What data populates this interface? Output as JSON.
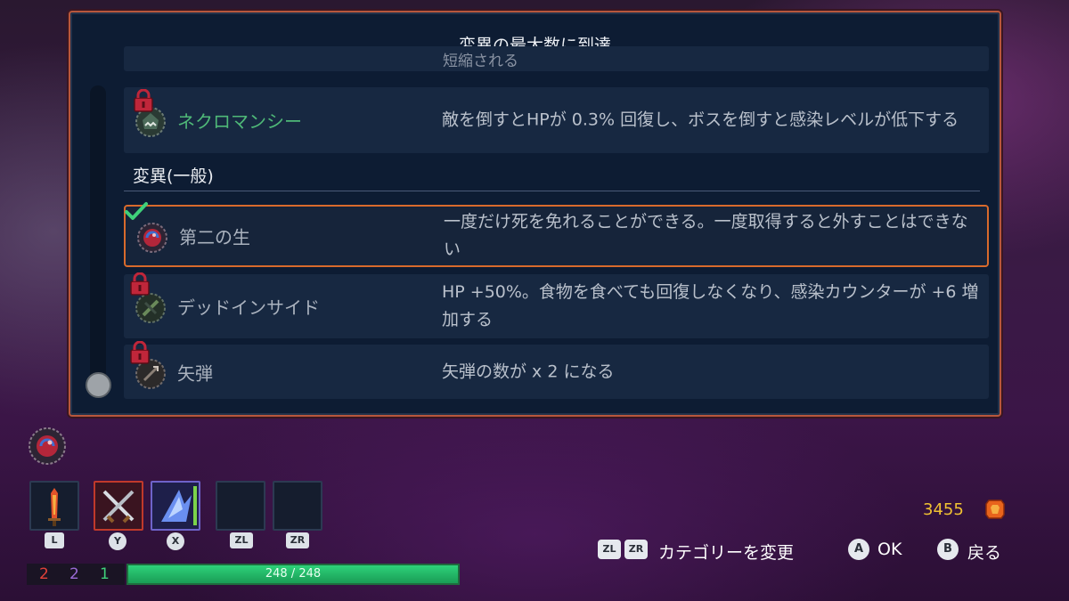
{
  "dialog": {
    "title": "変異の最大数に到達",
    "cut_row_text": "短縮される",
    "section_label": "変異(一般)"
  },
  "mutations": [
    {
      "name": "ネクロマンシー",
      "desc": "敵を倒すとHPが 0.3% 回復し、ボスを倒すと感染レベルが低下する",
      "locked": true,
      "selected": false,
      "icon": "necromancy-icon",
      "name_color": "#4fb978"
    },
    {
      "name": "第二の生",
      "desc": "一度だけ死を免れることができる。一度取得すると外すことはできない",
      "locked": false,
      "selected": true,
      "icon": "second-life-icon"
    },
    {
      "name": "デッドインサイド",
      "desc": "HP +50%。食物を食べても回復しなくなり、感染カウンターが +6 増加する",
      "locked": true,
      "selected": false,
      "icon": "dead-inside-icon"
    },
    {
      "name": "矢弾",
      "desc": "矢弾の数が x 2 になる",
      "locked": true,
      "selected": false,
      "icon": "ammo-icon"
    }
  ],
  "hud": {
    "slots": [
      {
        "key": "L",
        "icon": "fire-blade-icon"
      },
      {
        "key": "Y",
        "icon": "crossed-swords-icon"
      },
      {
        "key": "X",
        "icon": "ice-shard-icon"
      },
      {
        "key": "ZL",
        "icon": ""
      },
      {
        "key": "ZR",
        "icon": ""
      }
    ],
    "stats": {
      "brutality": "2",
      "tactics": "2",
      "survival": "1"
    },
    "hp_text": "248 / 248",
    "hp_fraction": 1.0,
    "gold": "3455"
  },
  "controls": {
    "category_btn_1": "ZL",
    "category_btn_2": "ZR",
    "category_label": "カテゴリーを変更",
    "ok_btn": "A",
    "ok_label": "OK",
    "back_btn": "B",
    "back_label": "戻る"
  },
  "colors": {
    "accent_orange": "#d86a2c",
    "brutality": "#e2413a",
    "tactics": "#9b6bd6",
    "survival": "#3fd07a",
    "gold": "#f1c232",
    "hp_green": "#2ed27a"
  }
}
